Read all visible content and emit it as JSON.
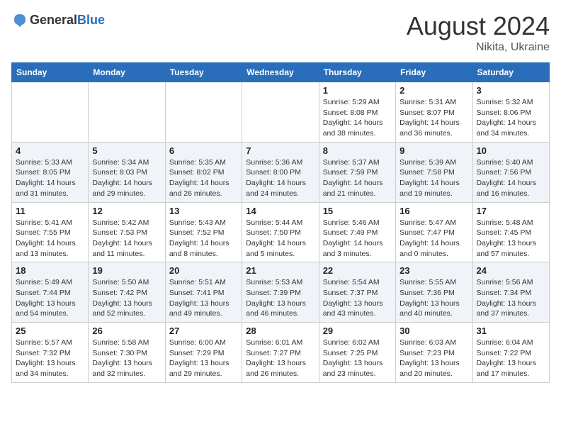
{
  "header": {
    "logo_general": "General",
    "logo_blue": "Blue",
    "month_year": "August 2024",
    "location": "Nikita, Ukraine"
  },
  "weekdays": [
    "Sunday",
    "Monday",
    "Tuesday",
    "Wednesday",
    "Thursday",
    "Friday",
    "Saturday"
  ],
  "weeks": [
    [
      {
        "day": "",
        "info": ""
      },
      {
        "day": "",
        "info": ""
      },
      {
        "day": "",
        "info": ""
      },
      {
        "day": "",
        "info": ""
      },
      {
        "day": "1",
        "info": "Sunrise: 5:29 AM\nSunset: 8:08 PM\nDaylight: 14 hours\nand 38 minutes."
      },
      {
        "day": "2",
        "info": "Sunrise: 5:31 AM\nSunset: 8:07 PM\nDaylight: 14 hours\nand 36 minutes."
      },
      {
        "day": "3",
        "info": "Sunrise: 5:32 AM\nSunset: 8:06 PM\nDaylight: 14 hours\nand 34 minutes."
      }
    ],
    [
      {
        "day": "4",
        "info": "Sunrise: 5:33 AM\nSunset: 8:05 PM\nDaylight: 14 hours\nand 31 minutes."
      },
      {
        "day": "5",
        "info": "Sunrise: 5:34 AM\nSunset: 8:03 PM\nDaylight: 14 hours\nand 29 minutes."
      },
      {
        "day": "6",
        "info": "Sunrise: 5:35 AM\nSunset: 8:02 PM\nDaylight: 14 hours\nand 26 minutes."
      },
      {
        "day": "7",
        "info": "Sunrise: 5:36 AM\nSunset: 8:00 PM\nDaylight: 14 hours\nand 24 minutes."
      },
      {
        "day": "8",
        "info": "Sunrise: 5:37 AM\nSunset: 7:59 PM\nDaylight: 14 hours\nand 21 minutes."
      },
      {
        "day": "9",
        "info": "Sunrise: 5:39 AM\nSunset: 7:58 PM\nDaylight: 14 hours\nand 19 minutes."
      },
      {
        "day": "10",
        "info": "Sunrise: 5:40 AM\nSunset: 7:56 PM\nDaylight: 14 hours\nand 16 minutes."
      }
    ],
    [
      {
        "day": "11",
        "info": "Sunrise: 5:41 AM\nSunset: 7:55 PM\nDaylight: 14 hours\nand 13 minutes."
      },
      {
        "day": "12",
        "info": "Sunrise: 5:42 AM\nSunset: 7:53 PM\nDaylight: 14 hours\nand 11 minutes."
      },
      {
        "day": "13",
        "info": "Sunrise: 5:43 AM\nSunset: 7:52 PM\nDaylight: 14 hours\nand 8 minutes."
      },
      {
        "day": "14",
        "info": "Sunrise: 5:44 AM\nSunset: 7:50 PM\nDaylight: 14 hours\nand 5 minutes."
      },
      {
        "day": "15",
        "info": "Sunrise: 5:46 AM\nSunset: 7:49 PM\nDaylight: 14 hours\nand 3 minutes."
      },
      {
        "day": "16",
        "info": "Sunrise: 5:47 AM\nSunset: 7:47 PM\nDaylight: 14 hours\nand 0 minutes."
      },
      {
        "day": "17",
        "info": "Sunrise: 5:48 AM\nSunset: 7:45 PM\nDaylight: 13 hours\nand 57 minutes."
      }
    ],
    [
      {
        "day": "18",
        "info": "Sunrise: 5:49 AM\nSunset: 7:44 PM\nDaylight: 13 hours\nand 54 minutes."
      },
      {
        "day": "19",
        "info": "Sunrise: 5:50 AM\nSunset: 7:42 PM\nDaylight: 13 hours\nand 52 minutes."
      },
      {
        "day": "20",
        "info": "Sunrise: 5:51 AM\nSunset: 7:41 PM\nDaylight: 13 hours\nand 49 minutes."
      },
      {
        "day": "21",
        "info": "Sunrise: 5:53 AM\nSunset: 7:39 PM\nDaylight: 13 hours\nand 46 minutes."
      },
      {
        "day": "22",
        "info": "Sunrise: 5:54 AM\nSunset: 7:37 PM\nDaylight: 13 hours\nand 43 minutes."
      },
      {
        "day": "23",
        "info": "Sunrise: 5:55 AM\nSunset: 7:36 PM\nDaylight: 13 hours\nand 40 minutes."
      },
      {
        "day": "24",
        "info": "Sunrise: 5:56 AM\nSunset: 7:34 PM\nDaylight: 13 hours\nand 37 minutes."
      }
    ],
    [
      {
        "day": "25",
        "info": "Sunrise: 5:57 AM\nSunset: 7:32 PM\nDaylight: 13 hours\nand 34 minutes."
      },
      {
        "day": "26",
        "info": "Sunrise: 5:58 AM\nSunset: 7:30 PM\nDaylight: 13 hours\nand 32 minutes."
      },
      {
        "day": "27",
        "info": "Sunrise: 6:00 AM\nSunset: 7:29 PM\nDaylight: 13 hours\nand 29 minutes."
      },
      {
        "day": "28",
        "info": "Sunrise: 6:01 AM\nSunset: 7:27 PM\nDaylight: 13 hours\nand 26 minutes."
      },
      {
        "day": "29",
        "info": "Sunrise: 6:02 AM\nSunset: 7:25 PM\nDaylight: 13 hours\nand 23 minutes."
      },
      {
        "day": "30",
        "info": "Sunrise: 6:03 AM\nSunset: 7:23 PM\nDaylight: 13 hours\nand 20 minutes."
      },
      {
        "day": "31",
        "info": "Sunrise: 6:04 AM\nSunset: 7:22 PM\nDaylight: 13 hours\nand 17 minutes."
      }
    ]
  ]
}
